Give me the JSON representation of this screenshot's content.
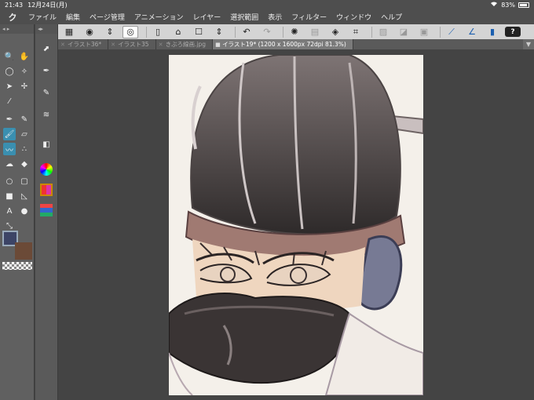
{
  "status": {
    "time": "21:43",
    "date": "12月24日(月)",
    "battery": "83%"
  },
  "menu": {
    "logo": "ク",
    "items": [
      "ファイル",
      "編集",
      "ページ管理",
      "アニメーション",
      "レイヤー",
      "選択範囲",
      "表示",
      "フィルター",
      "ウィンドウ",
      "ヘルプ"
    ]
  },
  "toolbar": {
    "help": "?"
  },
  "tabs": [
    {
      "label": "イラスト36*",
      "active": false
    },
    {
      "label": "イラスト35",
      "active": false
    },
    {
      "label": "きぶろ線画.jpg",
      "active": false
    },
    {
      "label": "イラスト19* (1200 x 1600px 72dpi 81.3%)",
      "active": true
    }
  ],
  "colors": {
    "main": "#3c4466",
    "sub": "#6b4a37",
    "accent": "#3a8fb0"
  }
}
